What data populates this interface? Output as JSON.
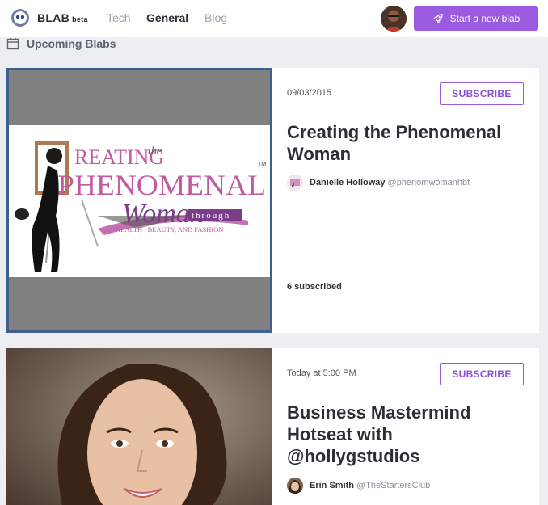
{
  "header": {
    "brand": "BLAB",
    "brand_badge": "beta",
    "nav": [
      {
        "label": "Tech",
        "active": false
      },
      {
        "label": "General",
        "active": true
      },
      {
        "label": "Blog",
        "active": false
      }
    ],
    "start_button_label": "Start a new blab",
    "start_button_icon": "rocket-icon",
    "accent_color": "#9a5be0"
  },
  "section": {
    "title": "Upcoming Blabs",
    "icon": "calendar-icon"
  },
  "blabs": [
    {
      "date": "09/03/2015",
      "subscribe_label": "SUBSCRIBE",
      "title": "Creating the Phenomenal Woman",
      "host_name": "Danielle Holloway",
      "host_handle": "@phenomwomanhbf",
      "subscribed": "6 subscribed",
      "thumbnail": {
        "line1": "REATING",
        "the": "the",
        "line2": "PHENOMENAL",
        "line3": "Woman",
        "through": "through",
        "tagline": "HEALTH , BEAUTY, AND FASHION",
        "tm": "TM"
      }
    },
    {
      "date": "Today at 5:00 PM",
      "subscribe_label": "SUBSCRIBE",
      "title": "Business Mastermind Hotseat with @hollygstudios",
      "host_name": "Erin Smith",
      "host_handle": "@TheStartersClub"
    }
  ]
}
